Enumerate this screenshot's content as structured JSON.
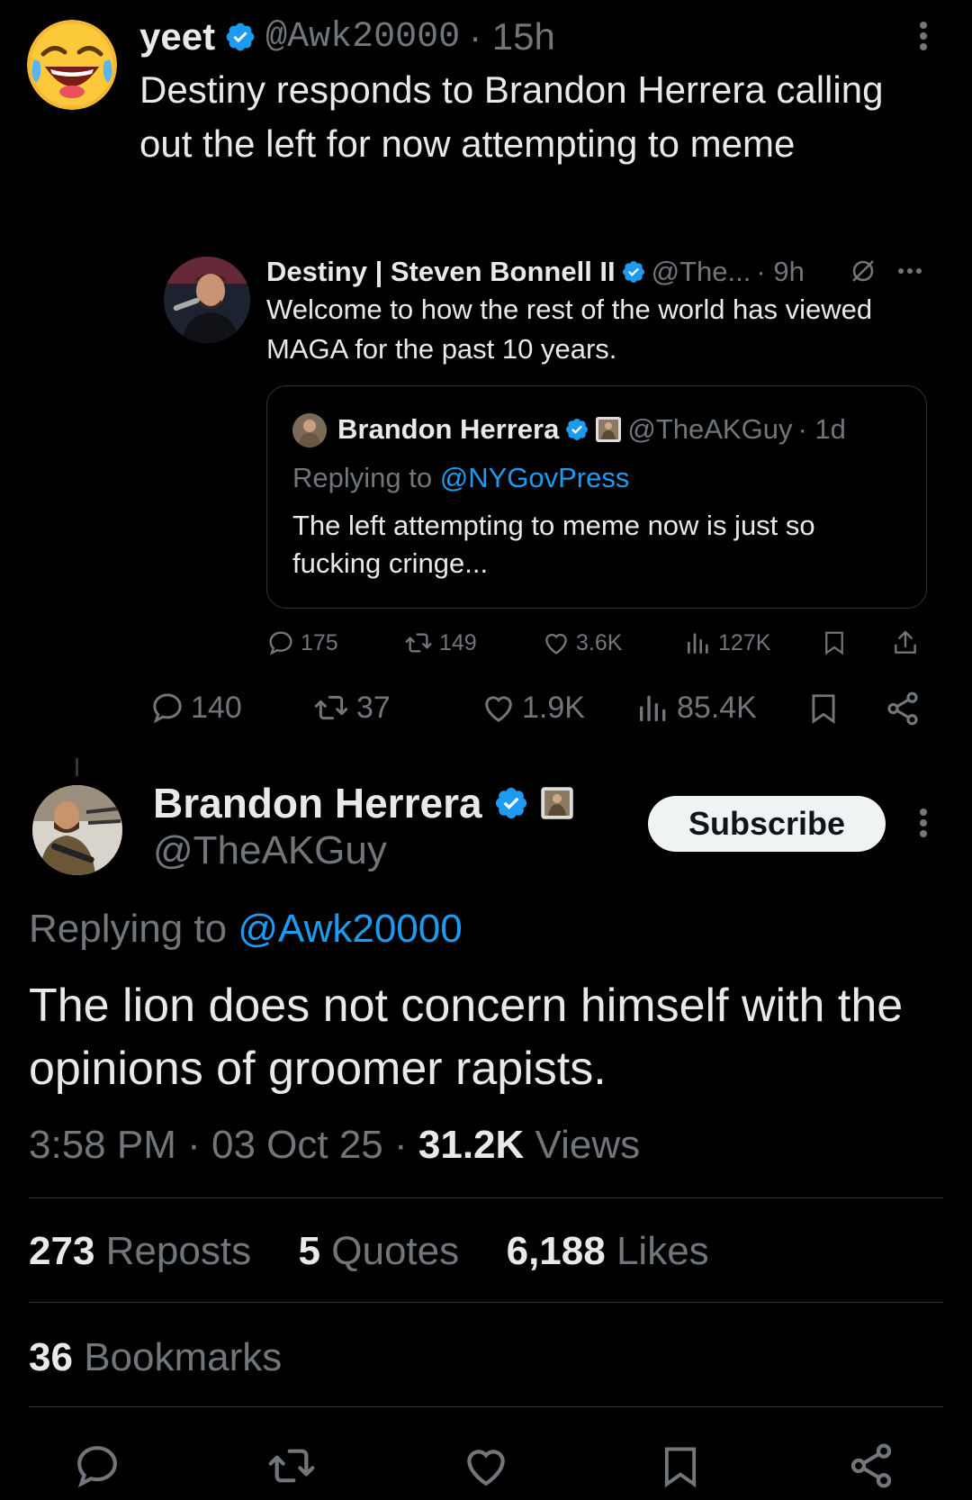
{
  "top_tweet": {
    "name": "yeet",
    "handle": "@Awk20000",
    "time": "· 15h",
    "text": "Destiny responds to Brandon Herrera calling out the left for now attempting to meme",
    "quote": {
      "name": "Destiny | Steven Bonnell II",
      "handle": "@The...",
      "time": "· 9h",
      "text": "Welcome to how the rest of the world has viewed MAGA for the past 10 years.",
      "inner": {
        "name": "Brandon Herrera",
        "handle": "@TheAKGuy",
        "time": "· 1d",
        "replying_prefix": "Replying to",
        "replying_to": "@NYGovPress",
        "text": "The left attempting to meme now is just so fucking cringe..."
      },
      "stats": {
        "replies": "175",
        "reposts": "149",
        "likes": "3.6K",
        "views": "127K"
      }
    },
    "stats": {
      "replies": "140",
      "reposts": "37",
      "likes": "1.9K",
      "views": "85.4K"
    }
  },
  "reply": {
    "name": "Brandon Herrera",
    "handle": "@TheAKGuy",
    "subscribe_label": "Subscribe",
    "replying_prefix": "Replying to",
    "replying_to": "@Awk20000",
    "text": "The lion does not concern himself with the opinions of groomer rapists.",
    "time": "3:58 PM",
    "date": "03 Oct 25",
    "views_count": "31.2K",
    "views_label": "Views",
    "reposts_count": "273",
    "reposts_label": "Reposts",
    "quotes_count": "5",
    "quotes_label": "Quotes",
    "likes_count": "6,188",
    "likes_label": "Likes",
    "bookmarks_count": "36",
    "bookmarks_label": "Bookmarks"
  },
  "colors": {
    "accent": "#1d9bf0",
    "muted": "#71767b",
    "text": "#e7e9ea",
    "divider": "#2f3336"
  }
}
